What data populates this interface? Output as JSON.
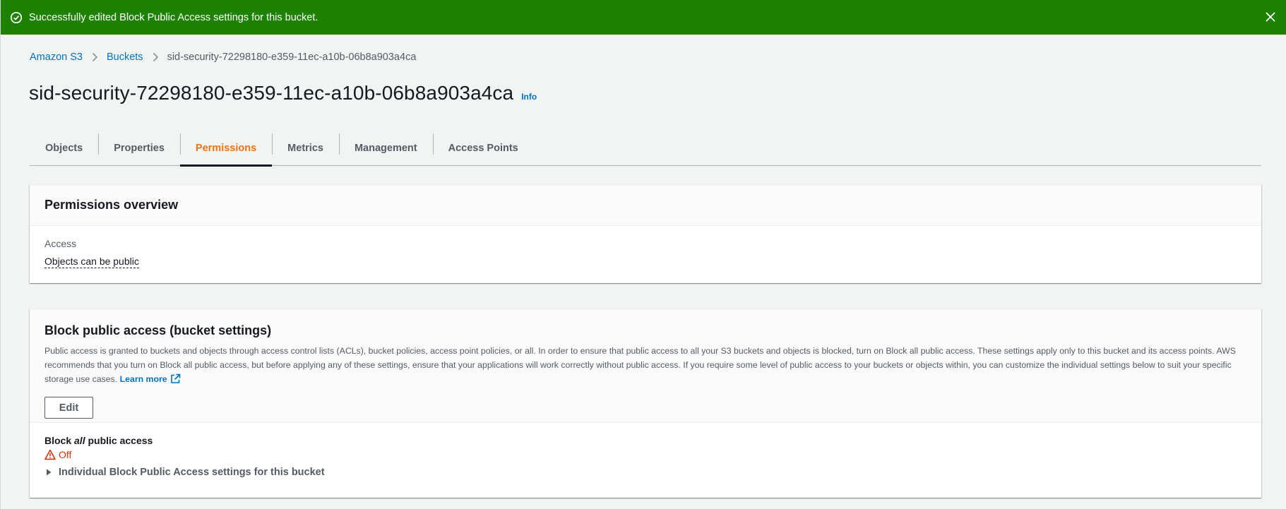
{
  "flash": {
    "message": "Successfully edited Block Public Access settings for this bucket.",
    "icon": "check-circle-icon",
    "close_icon": "close-icon",
    "color": "#1d8102"
  },
  "breadcrumb": {
    "items": [
      {
        "label": "Amazon S3"
      },
      {
        "label": "Buckets"
      },
      {
        "label": "sid-security-72298180-e359-11ec-a10b-06b8a903a4ca"
      }
    ]
  },
  "header": {
    "title": "sid-security-72298180-e359-11ec-a10b-06b8a903a4ca",
    "info": "Info"
  },
  "tabs": [
    {
      "label": "Objects"
    },
    {
      "label": "Properties"
    },
    {
      "label": "Permissions",
      "active": true
    },
    {
      "label": "Metrics"
    },
    {
      "label": "Management"
    },
    {
      "label": "Access Points"
    }
  ],
  "permissions_overview": {
    "title": "Permissions overview",
    "access_label": "Access",
    "access_value": "Objects can be public"
  },
  "block_public_access": {
    "title": "Block public access (bucket settings)",
    "description": "Public access is granted to buckets and objects through access control lists (ACLs), bucket policies, access point policies, or all. In order to ensure that public access to all your S3 buckets and objects is blocked, turn on Block all public access. These settings apply only to this bucket and its access points. AWS recommends that you turn on Block all public access, but before applying any of these settings, ensure that your applications will work correctly without public access. If you require some level of public access to your buckets or objects within, you can customize the individual settings below to suit your specific storage use cases.",
    "learn_more": "Learn more",
    "edit_label": "Edit",
    "block_prefix": "Block",
    "block_emphasis": "all",
    "block_suffix": "public access",
    "status": "Off",
    "status_color": "#d13212",
    "expander_label": "Individual Block Public Access settings for this bucket"
  },
  "colors": {
    "link": "#0073bb",
    "active_tab": "#ec7211"
  }
}
